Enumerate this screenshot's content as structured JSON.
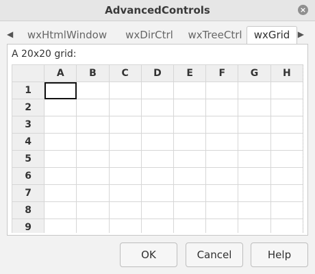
{
  "window": {
    "title": "AdvancedControls"
  },
  "tabs": [
    {
      "label": "wxHtmlWindow"
    },
    {
      "label": "wxDirCtrl"
    },
    {
      "label": "wxTreeCtrl"
    },
    {
      "label": "wxGrid"
    }
  ],
  "active_tab_index": 3,
  "panel": {
    "label": "A 20x20 grid:"
  },
  "grid": {
    "columns": [
      "A",
      "B",
      "C",
      "D",
      "E",
      "F",
      "G",
      "H"
    ],
    "rows": [
      "1",
      "2",
      "3",
      "4",
      "5",
      "6",
      "7",
      "8",
      "9"
    ],
    "selected_cell": "A1"
  },
  "buttons": {
    "ok": "OK",
    "cancel": "Cancel",
    "help": "Help"
  }
}
